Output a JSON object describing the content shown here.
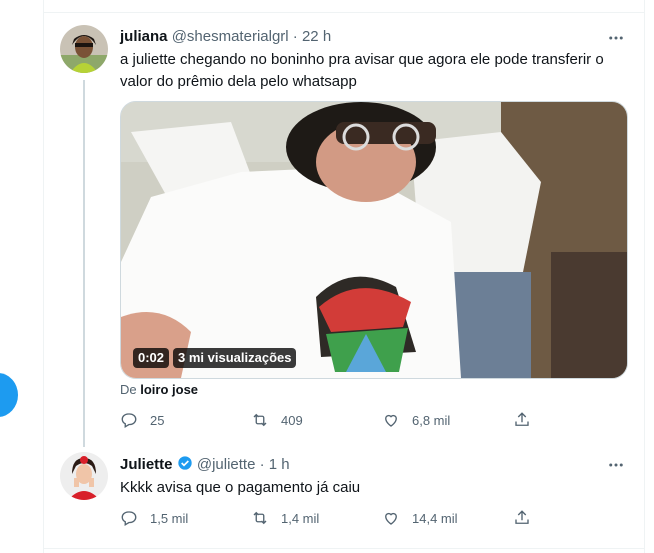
{
  "tweet1": {
    "display_name": "juliana",
    "handle": "@shesmaterialgrl",
    "separator": "·",
    "time": "22 h",
    "text": "a juliette chegando no boninho pra avisar que agora ele pode transferir o valor do prêmio dela pelo whatsapp",
    "video": {
      "duration": "0:02",
      "views": "3 mi visualizações"
    },
    "from_prefix": "De",
    "from_user": "loiro jose",
    "actions": {
      "replies": "25",
      "retweets": "409",
      "likes": "6,8 mil"
    }
  },
  "tweet2": {
    "display_name": "Juliette",
    "handle": "@juliette",
    "separator": "·",
    "time": "1 h",
    "text": "Kkkk avisa que o pagamento já caiu",
    "actions": {
      "replies": "1,5 mil",
      "retweets": "1,4 mil",
      "likes": "14,4 mil"
    }
  },
  "colors": {
    "accent": "#1d9bf0",
    "text": "#0f1419",
    "muted": "#536471",
    "border": "#eff3f4"
  },
  "icons": [
    "more-icon",
    "reply-icon",
    "retweet-icon",
    "like-icon",
    "share-icon",
    "verified-icon",
    "compose-icon"
  ]
}
